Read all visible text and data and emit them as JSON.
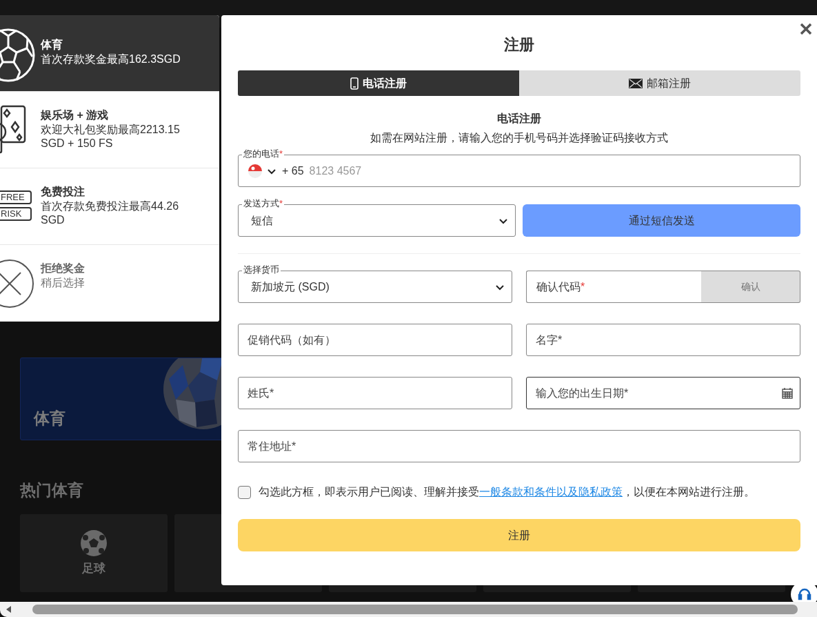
{
  "background": {
    "banner": {
      "title": "体育",
      "kind": "picture"
    },
    "section_title": "热门体育",
    "sport_tiles": [
      {
        "label": "足球"
      }
    ]
  },
  "bonuses": [
    {
      "kind": "sports",
      "title": "体育",
      "description": "首次存款奖金最高162.3SGD",
      "selected": true
    },
    {
      "kind": "casino",
      "title": "娱乐场 + 游戏",
      "description": "欢迎大礼包奖励最高2213.15 SGD + 150 FS",
      "selected": false
    },
    {
      "kind": "freebet",
      "title": "免费投注",
      "description": "首次存款免费投注最高44.26 SGD",
      "badges": [
        "FREE",
        "RISK"
      ],
      "selected": false
    },
    {
      "kind": "decline",
      "title": "拒绝奖金",
      "description": "稍后选择",
      "selected": false
    }
  ],
  "modal": {
    "title": "注册",
    "tabs": [
      {
        "label": "电话注册",
        "kind": "phone",
        "selected": true
      },
      {
        "label": "邮箱注册",
        "kind": "email",
        "selected": false
      }
    ],
    "heading": "电话注册",
    "subtitle": "如需在网站注册，请输入您的手机号码并选择验证码接收方式",
    "phone": {
      "label": "您的电话",
      "required_mark": "*",
      "code": "+ 65",
      "placeholder": "8123 4567"
    },
    "send_method": {
      "label": "发送方式",
      "required_mark": "*",
      "value": "短信"
    },
    "send_button": "通过短信发送",
    "currency": {
      "label": "选择货币",
      "value": "新加坡元 (SGD)"
    },
    "code_field": {
      "placeholder": "确认代码",
      "required_mark": "*"
    },
    "confirm_button": "确认",
    "fields": [
      {
        "placeholder": "促销代码（如有）",
        "kind": "text"
      },
      {
        "placeholder": "名字*",
        "kind": "text"
      },
      {
        "placeholder": "姓氏*",
        "kind": "text"
      },
      {
        "placeholder": "输入您的出生日期*",
        "kind": "date"
      },
      {
        "placeholder": "常住地址*",
        "kind": "wide"
      }
    ],
    "terms": {
      "checked": false,
      "before": "勾选此方框，即表示用户已阅读、理解并接受",
      "link": "一般条款和条件以及隐私政策",
      "after": "，以便在本网站进行注册。"
    },
    "submit": "注册"
  }
}
